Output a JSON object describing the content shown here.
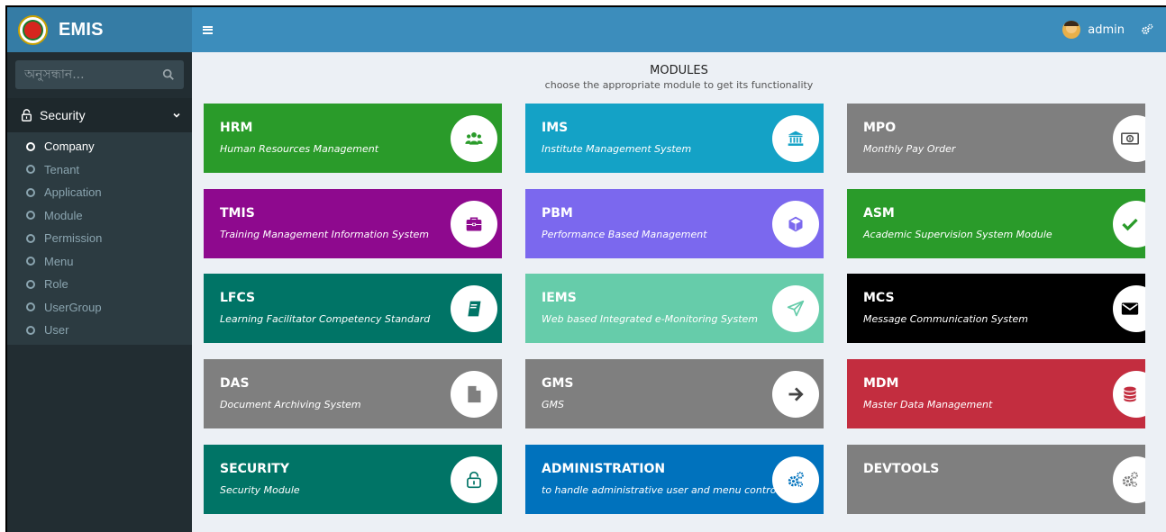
{
  "brand": {
    "title": "EMIS"
  },
  "search": {
    "placeholder": "অনুসন্ধান..."
  },
  "sidebar": {
    "section_label": "Security",
    "items": [
      {
        "label": "Company",
        "active": true
      },
      {
        "label": "Tenant"
      },
      {
        "label": "Application"
      },
      {
        "label": "Module"
      },
      {
        "label": "Permission"
      },
      {
        "label": "Menu"
      },
      {
        "label": "Role"
      },
      {
        "label": "UserGroup"
      },
      {
        "label": "User"
      }
    ]
  },
  "topbar": {
    "user_name": "admin"
  },
  "heading": {
    "title": "MODULES",
    "subtitle": "choose the appropriate module to get its functionality"
  },
  "modules": [
    {
      "code": "HRM",
      "description": "Human Resources Management",
      "color": "#2a9b2a",
      "icon_color": "#2a9b2a",
      "icon": "users-icon"
    },
    {
      "code": "IMS",
      "description": "Institute Management System",
      "color": "#14a2c6",
      "icon_color": "#14a2c6",
      "icon": "institution-icon"
    },
    {
      "code": "MPO",
      "description": "Monthly Pay Order",
      "color": "#7f7f7f",
      "icon_color": "#555555",
      "icon": "money-icon"
    },
    {
      "code": "TMIS",
      "description": "Training Management Information System",
      "color": "#8e098e",
      "icon_color": "#8e098e",
      "icon": "briefcase-icon"
    },
    {
      "code": "PBM",
      "description": "Performance Based Management",
      "color": "#7b68ee",
      "icon_color": "#7b68ee",
      "icon": "cube-icon"
    },
    {
      "code": "ASM",
      "description": "Academic Supervision System Module",
      "color": "#2a9b2a",
      "icon_color": "#2a9b2a",
      "icon": "check-icon"
    },
    {
      "code": "LFCS",
      "description": "Learning Facilitator Competency Standard",
      "color": "#007466",
      "icon_color": "#007466",
      "icon": "book-icon"
    },
    {
      "code": "IEMS",
      "description": "Web based Integrated e-Monitoring System",
      "color": "#66ccaa",
      "icon_color": "#66ccaa",
      "icon": "paper-plane-icon"
    },
    {
      "code": "MCS",
      "description": "Message Communication System",
      "color": "#000000",
      "icon_color": "#000000",
      "icon": "envelope-icon"
    },
    {
      "code": "DAS",
      "description": "Document Archiving System",
      "color": "#7f7f7f",
      "icon_color": "#7f7f7f",
      "icon": "file-icon"
    },
    {
      "code": "GMS",
      "description": "GMS",
      "color": "#7f7f7f",
      "icon_color": "#444444",
      "icon": "arrow-right-icon"
    },
    {
      "code": "MDM",
      "description": "Master Data Management",
      "color": "#c32d3f",
      "icon_color": "#c32d3f",
      "icon": "database-icon"
    },
    {
      "code": "SECURITY",
      "description": "Security Module",
      "color": "#007466",
      "icon_color": "#007466",
      "icon": "lock-icon"
    },
    {
      "code": "ADMINISTRATION",
      "description": "to handle administrative user and menu control",
      "color": "#0072bd",
      "icon_color": "#0072bd",
      "icon": "gears-icon"
    },
    {
      "code": "DEVTOOLS",
      "description": "",
      "color": "#7f7f7f",
      "icon_color": "#7f7f7f",
      "icon": "gears-icon"
    }
  ]
}
